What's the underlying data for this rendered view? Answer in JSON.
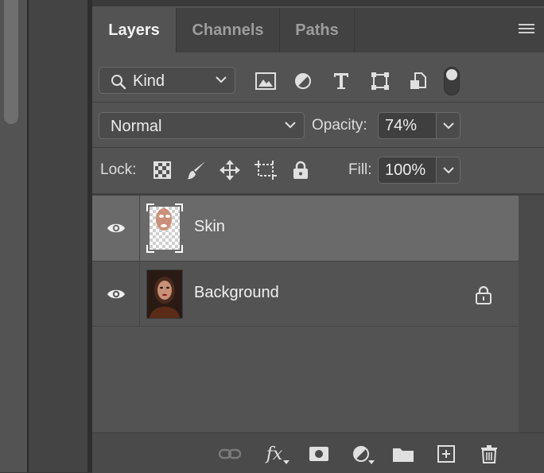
{
  "tabs": [
    {
      "label": "Layers",
      "active": true
    },
    {
      "label": "Channels",
      "active": false
    },
    {
      "label": "Paths",
      "active": false
    }
  ],
  "filter": {
    "kind_label": "Kind",
    "filter_icons": [
      "image-filter-icon",
      "adjustment-filter-icon",
      "type-filter-icon",
      "shape-filter-icon",
      "smart-object-filter-icon"
    ]
  },
  "blend": {
    "mode": "Normal",
    "opacity_label": "Opacity:",
    "opacity_value": "74%"
  },
  "lock": {
    "label": "Lock:",
    "fill_label": "Fill:",
    "fill_value": "100%",
    "lock_icons": [
      "lock-transparent-pixels-icon",
      "lock-image-pixels-icon",
      "lock-position-icon",
      "lock-artboard-icon",
      "lock-all-icon"
    ]
  },
  "layers": [
    {
      "name": "Skin",
      "visible": true,
      "selected": true,
      "locked": false
    },
    {
      "name": "Background",
      "visible": true,
      "selected": false,
      "locked": true
    }
  ],
  "bottom_icons": [
    "link-layers-icon",
    "fx-icon",
    "add-mask-icon",
    "adjustment-layer-icon",
    "new-group-icon",
    "new-layer-icon",
    "delete-layer-icon"
  ],
  "bottom": {
    "fx_label": "fx"
  },
  "colors": {
    "panel_bg": "#535353",
    "selected_row": "#6a6a6a",
    "text": "#e6e6e6"
  }
}
